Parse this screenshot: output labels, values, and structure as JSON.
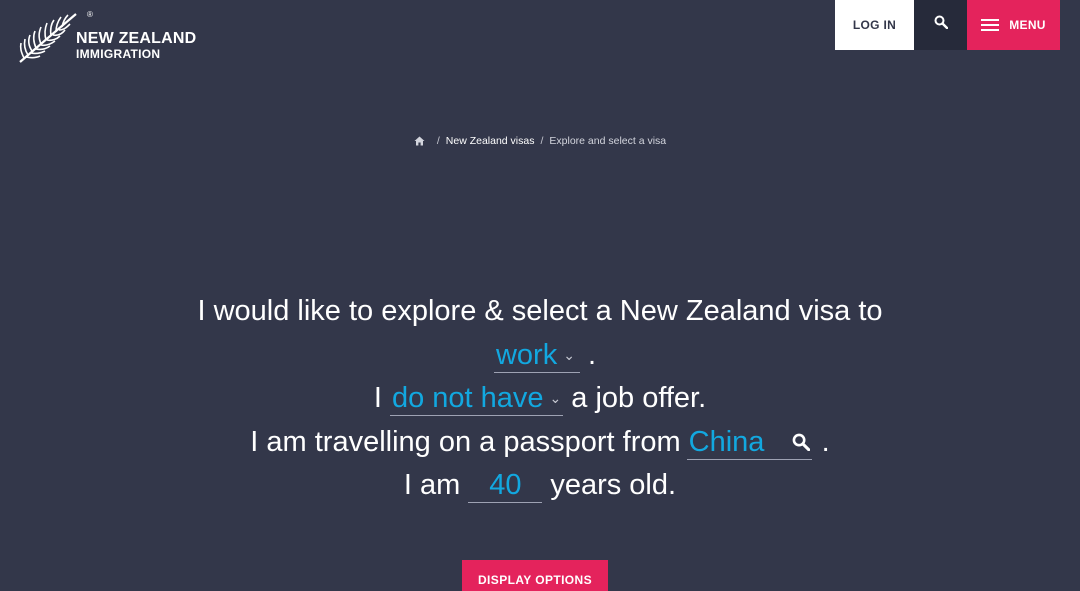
{
  "header": {
    "logo_line1": "NEW ZEALAND",
    "logo_line2": "IMMIGRATION",
    "logo_reg": "®",
    "login_label": "LOG IN",
    "search_icon": "search-icon",
    "menu_label": "MENU"
  },
  "breadcrumb": {
    "home_icon": "home-icon",
    "separator": "/",
    "items": [
      "New Zealand visas",
      "Explore and select a visa"
    ]
  },
  "form": {
    "line1": "I would like to explore & select a New Zealand visa to",
    "purpose_value": "work",
    "line2_end": ".",
    "line3_start": "I",
    "job_offer_value": "do not have",
    "line3_end": "a job offer.",
    "line4_start": "I am travelling on a passport from",
    "country_value": "China",
    "line4_end": ".",
    "line5_start": "I am",
    "age_value": "40",
    "line5_end": "years old."
  },
  "display_options_label": "DISPLAY OPTIONS",
  "colors": {
    "background": "#33374a",
    "accent_pink": "#e4235c",
    "field_blue": "#12a8e0"
  }
}
